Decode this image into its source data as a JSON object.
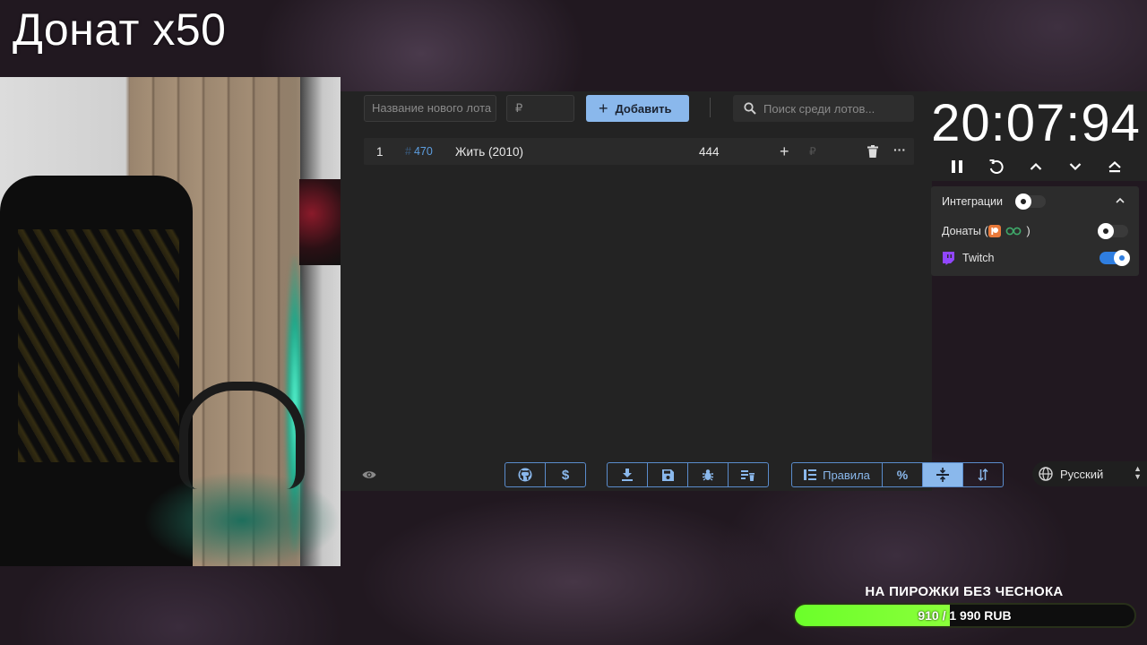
{
  "overlay": {
    "title": "Донат x50"
  },
  "toolbar": {
    "lot_name_placeholder": "Название нового лота",
    "lot_amount_placeholder": "₽",
    "add_label": "Добавить",
    "search_placeholder": "Поиск среди лотов..."
  },
  "lots": [
    {
      "index": "1",
      "id": "470",
      "id_prefix": "#",
      "title": "Жить (2010)",
      "amount": "444",
      "add_icon": "plus-icon",
      "currency": "₽",
      "delete_icon": "trash-icon",
      "more_icon": "more-horizontal-icon"
    }
  ],
  "bottom_bar": {
    "visibility_icon": "eye-icon",
    "github_icon": "github-icon",
    "donate_icon": "dollar-icon",
    "download_icon": "download-icon",
    "save_icon": "save-icon",
    "bug_icon": "bug-icon",
    "clear_icon": "delete-list-icon",
    "rules_label": "Правила",
    "percent_label": "%",
    "compress_icon": "compress-icon",
    "sort_icon": "sort-icon",
    "active_tool": "compress"
  },
  "language": {
    "selected": "Русский",
    "icon": "globe-icon"
  },
  "timer": {
    "value": "20:07:94",
    "controls": [
      "pause-icon",
      "reset-icon",
      "chevron-up-icon",
      "chevron-down-icon",
      "eject-icon"
    ]
  },
  "integrations": {
    "title": "Интеграции",
    "title_toggle_on": false,
    "items": [
      {
        "label_prefix": "Донаты (",
        "label_suffix": ")",
        "toggle_on": false,
        "icons": [
          "patreon-icon",
          "loop-icon"
        ]
      },
      {
        "label": "Twitch",
        "toggle_on": true,
        "icon": "twitch-icon"
      }
    ]
  },
  "goal": {
    "title": "НА ПИРОЖКИ БЕЗ ЧЕСНОКА",
    "text": "910 / 1 990 RUB",
    "current": 910,
    "target": 1990
  },
  "colors": {
    "accent": "#8ab8ec",
    "toggle_on": "#2f7ee0",
    "goal_fill": "#6bff2a",
    "lot_id": "#5d9ee0",
    "twitch": "#9146ff",
    "patreon": "#f96854"
  }
}
